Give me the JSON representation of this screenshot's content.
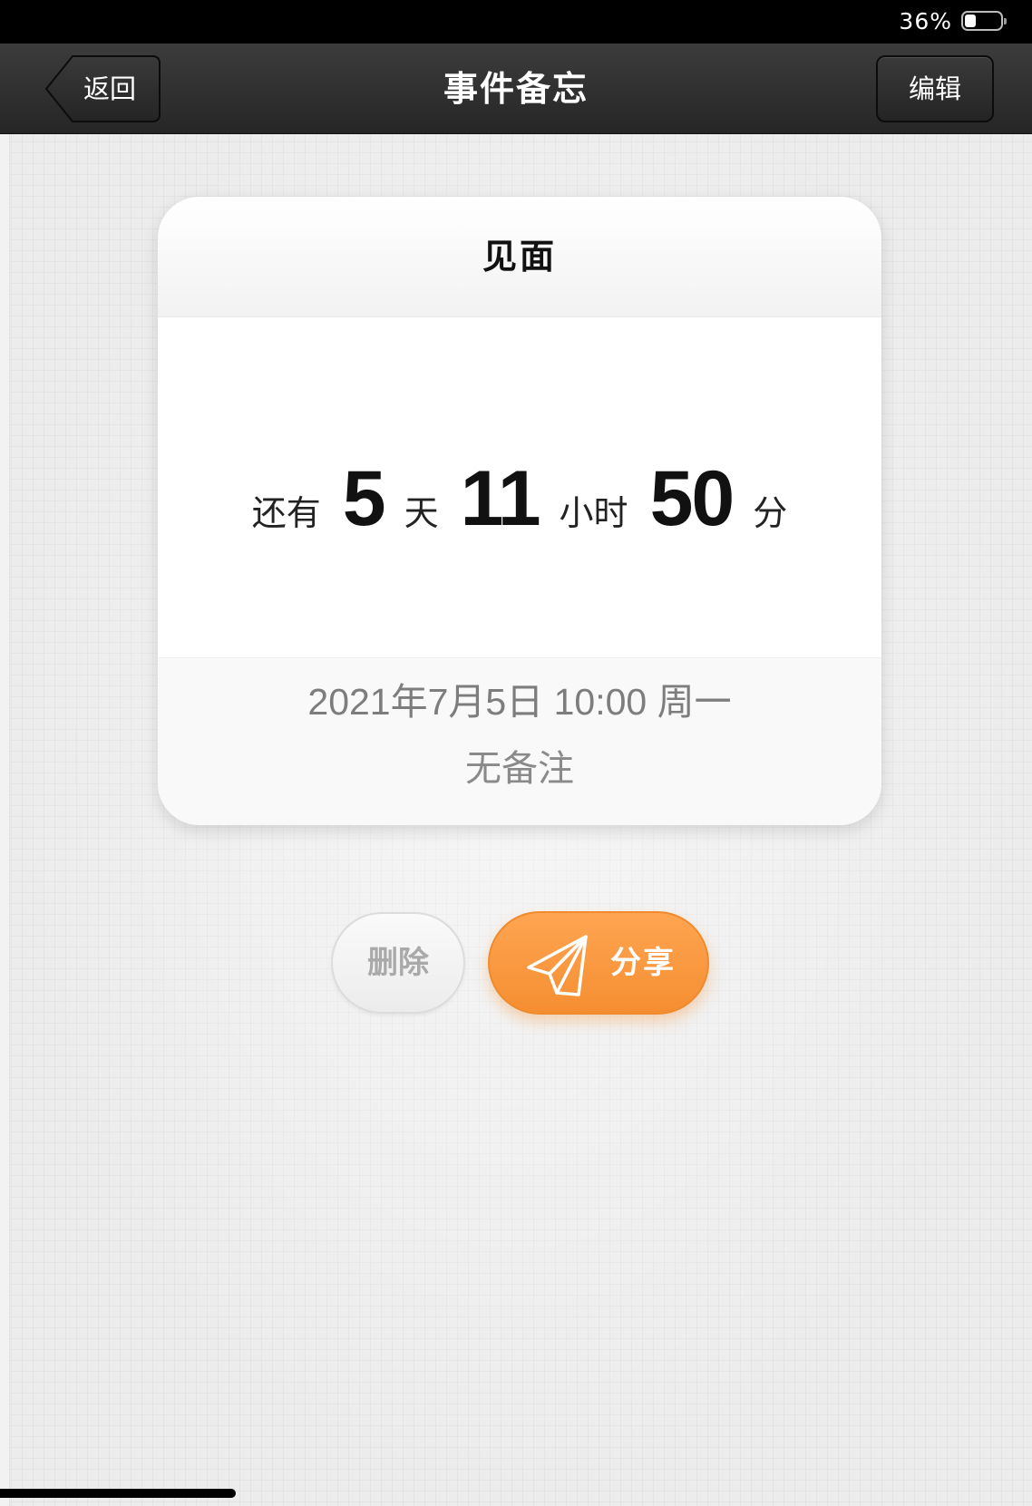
{
  "status_bar": {
    "battery_text": "36%",
    "battery_level": 0.36
  },
  "nav": {
    "back_label": "返回",
    "title": "事件备忘",
    "edit_label": "编辑"
  },
  "event": {
    "title": "见面",
    "countdown": {
      "prefix": "还有",
      "days": "5",
      "days_unit": "天",
      "hours": "11",
      "hours_unit": "小时",
      "minutes": "50",
      "minutes_unit": "分"
    },
    "datetime": "2021年7月5日 10:00 周一",
    "note": "无备注"
  },
  "actions": {
    "delete_label": "删除",
    "share_label": "分享",
    "share_color": "#f7953a"
  },
  "icons": {
    "back": "back-arrow-icon",
    "share": "paper-plane-icon",
    "battery": "battery-icon"
  }
}
